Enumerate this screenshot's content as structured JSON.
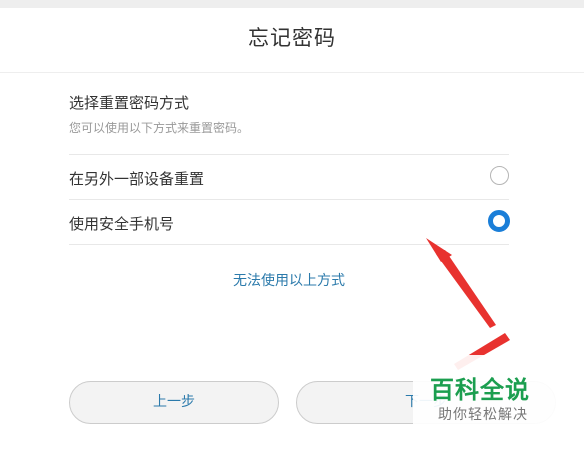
{
  "dialog": {
    "title": "忘记密码",
    "heading": "选择重置密码方式",
    "subheading": "您可以使用以下方式来重置密码。"
  },
  "options": [
    {
      "label": "在另外一部设备重置",
      "selected": false
    },
    {
      "label": "使用安全手机号",
      "selected": true
    }
  ],
  "alternate_link": "无法使用以上方式",
  "buttons": {
    "back": "上一步",
    "next": "下一步"
  },
  "watermark": {
    "title": "百科全说",
    "subtitle": "助你轻松解决"
  },
  "colors": {
    "link": "#2b7aab",
    "radio_selected": "#1a7ed8",
    "annotation_arrow": "#e8322f",
    "watermark_green": "#1b9e4f"
  }
}
